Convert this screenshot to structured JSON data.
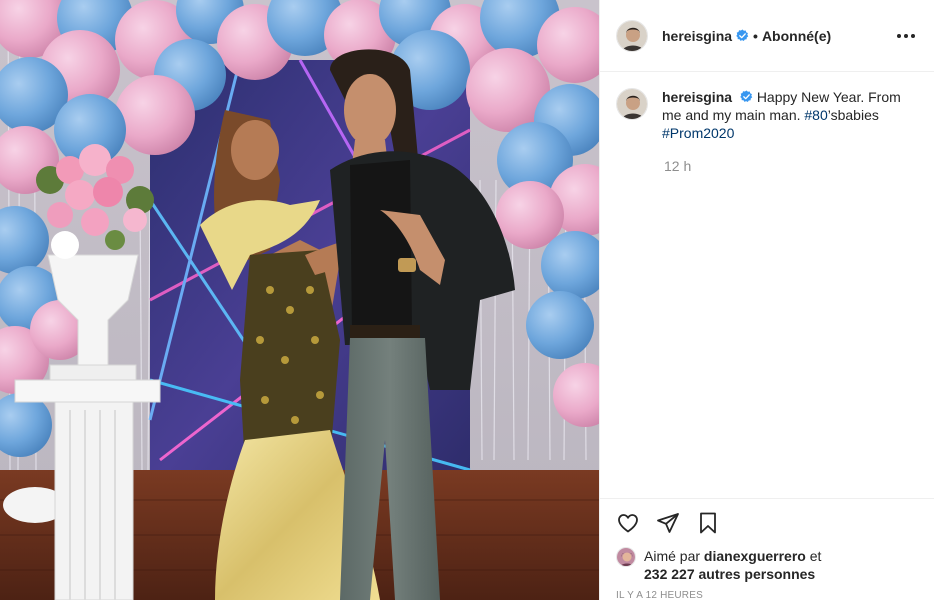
{
  "post": {
    "author": {
      "username": "hereisgina",
      "verified": true,
      "follow_status": "Abonné(e)"
    },
    "caption": {
      "username": "hereisgina",
      "text_before": "Happy New Year. From me and my main man.",
      "hashtag_1": "#80",
      "text_middle": "’sbabies",
      "hashtag_2": "#Prom2020",
      "time_ago": "12 h"
    },
    "likes": {
      "prefix": "Aimé par",
      "liked_by": "dianexguerrero",
      "connector": "et",
      "count_text": "232 227 autres personnes"
    },
    "timestamp": "IL Y A 12 HEURES",
    "icons": {
      "more": "more-options-icon",
      "like": "heart-icon",
      "share": "paper-plane-icon",
      "save": "bookmark-icon",
      "verified": "verified-badge-icon"
    },
    "colors": {
      "text": "#262626",
      "secondary": "#8e8e8e",
      "hashtag": "#00376b",
      "verified": "#3897f0",
      "border": "#efefef"
    }
  }
}
